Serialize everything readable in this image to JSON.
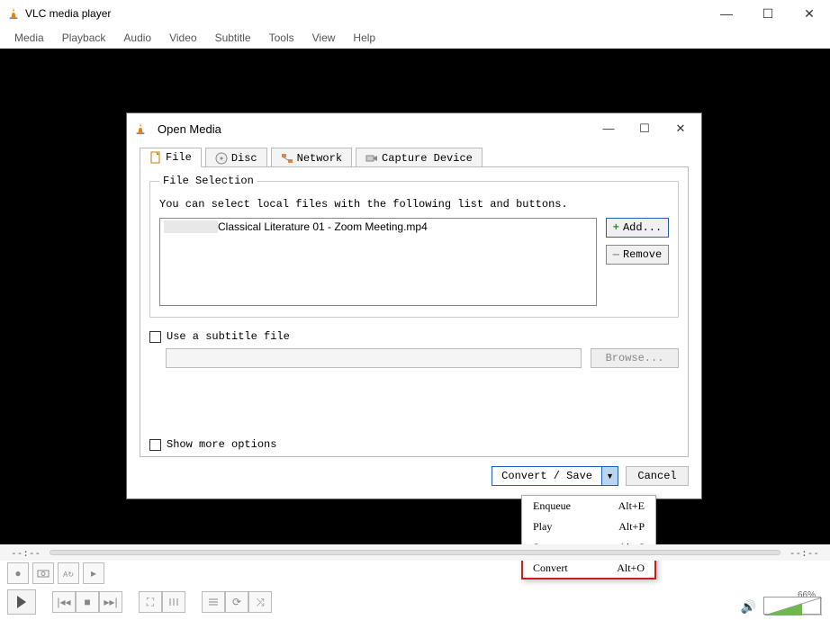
{
  "app": {
    "title": "VLC media player"
  },
  "menu": [
    "Media",
    "Playback",
    "Audio",
    "Video",
    "Subtitle",
    "Tools",
    "View",
    "Help"
  ],
  "dialog": {
    "title": "Open Media",
    "tabs": [
      {
        "label": "File",
        "icon": "file-icon"
      },
      {
        "label": "Disc",
        "icon": "disc-icon"
      },
      {
        "label": "Network",
        "icon": "network-icon"
      },
      {
        "label": "Capture Device",
        "icon": "capture-icon"
      }
    ],
    "fileSelection": {
      "legend": "File Selection",
      "hint": "You can select local files with the following list and buttons.",
      "files": [
        "Classical Literature 01 - Zoom Meeting.mp4"
      ],
      "addLabel": "Add...",
      "removeLabel": "Remove"
    },
    "subtitle": {
      "checkboxLabel": "Use a subtitle file",
      "browseLabel": "Browse..."
    },
    "showMore": "Show more options",
    "convertLabel": "Convert / Save",
    "cancelLabel": "Cancel"
  },
  "dropdown": [
    {
      "label": "Enqueue",
      "shortcut": "Alt+E"
    },
    {
      "label": "Play",
      "shortcut": "Alt+P"
    },
    {
      "label": "Stream",
      "shortcut": "Alt+S"
    },
    {
      "label": "Convert",
      "shortcut": "Alt+O",
      "highlighted": true
    }
  ],
  "seek": {
    "leftDash": "--:--",
    "rightDash": "--:--"
  },
  "volume": {
    "percent": "66%"
  }
}
